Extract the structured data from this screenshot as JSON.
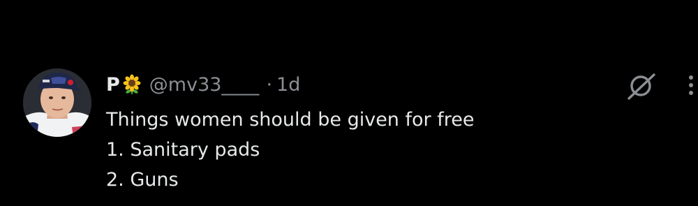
{
  "tweet": {
    "display_name": "P",
    "name_emoji": "sunflower",
    "handle": "@mv33____",
    "separator": "·",
    "time": "1d",
    "lines": [
      "Things women should be given for free",
      "1. Sanitary pads",
      "2. Guns"
    ]
  },
  "icons": {
    "avatar": "profile-photo",
    "grok": "grok-icon",
    "more": "more-dots-icon"
  },
  "colors": {
    "background": "#000000",
    "text_primary": "#e7e9ea",
    "text_secondary": "#8b8f94"
  }
}
